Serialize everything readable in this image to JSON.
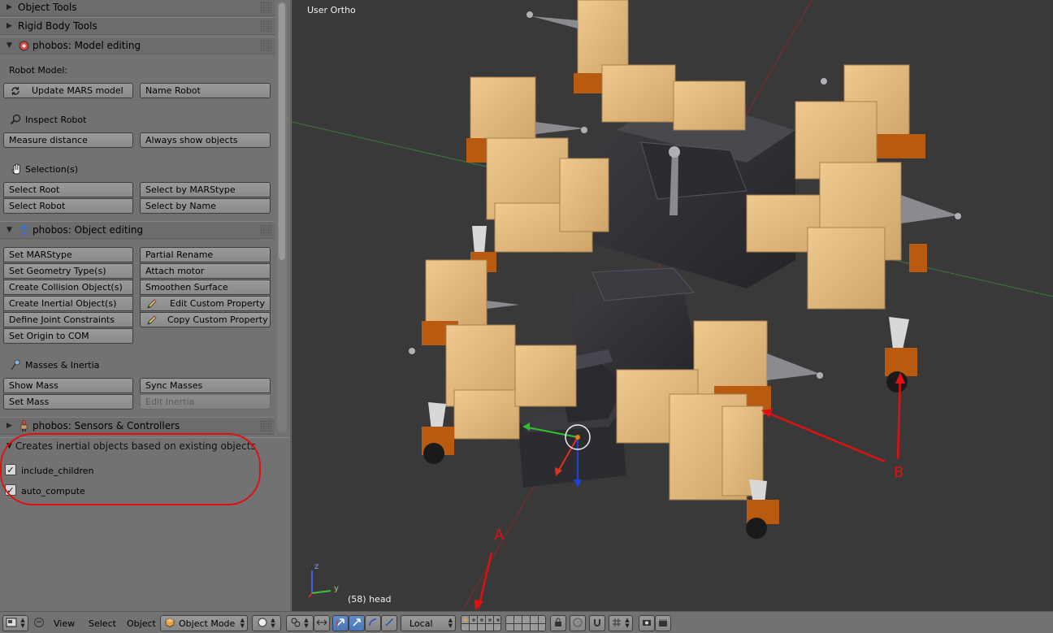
{
  "panel": {
    "sections": {
      "object_tools": "Object Tools",
      "rigid_body_tools": "Rigid Body Tools",
      "model_editing": "phobos: Model editing",
      "object_editing": "phobos: Object editing",
      "sensors_controllers": "phobos: Sensors & Controllers"
    },
    "robot_model_label": "Robot Model:",
    "update_mars_model": "Update MARS model",
    "name_robot": "Name Robot",
    "inspect_robot": "Inspect Robot",
    "measure_distance": "Measure distance",
    "always_show_objects": "Always show objects",
    "selections": "Selection(s)",
    "select_root": "Select Root",
    "select_by_marstype": "Select by MARStype",
    "select_robot": "Select Robot",
    "select_by_name": "Select by Name",
    "set_marstype": "Set MARStype",
    "partial_rename": "Partial Rename",
    "set_geometry_types": "Set Geometry Type(s)",
    "attach_motor": "Attach motor",
    "create_collision_objects": "Create Collision Object(s)",
    "smoothen_surface": "Smoothen Surface",
    "create_inertial_objects": "Create Inertial Object(s)",
    "edit_custom_property": "Edit Custom Property",
    "define_joint_constraints": "Define Joint Constraints",
    "copy_custom_property": "Copy Custom Property",
    "set_origin_to_com": "Set Origin to COM",
    "masses_inertia": "Masses & Inertia",
    "show_mass": "Show Mass",
    "sync_masses": "Sync Masses",
    "set_mass": "Set Mass",
    "edit_inertia": "Edit Inertia"
  },
  "redo_panel": {
    "title": "Creates inertial objects based on existing objects",
    "include_children": "include_children",
    "include_children_checked": true,
    "auto_compute": "auto_compute",
    "auto_compute_checked": true
  },
  "viewport": {
    "view_name": "User Ortho",
    "active_object": "(58) head",
    "annotation_a": "A",
    "annotation_b": "B",
    "axis_z": "z",
    "axis_y": "y"
  },
  "header": {
    "view_menu": "View",
    "select_menu": "Select",
    "object_menu": "Object",
    "mode": "Object Mode",
    "orientation": "Local"
  },
  "colors": {
    "annotation_red": "#e01010",
    "robot_tan": "#e2bb80",
    "robot_orange": "#b85a10",
    "body_dark": "#2e2e33",
    "viewport_bg": "#393939",
    "panel_bg": "#727272"
  }
}
